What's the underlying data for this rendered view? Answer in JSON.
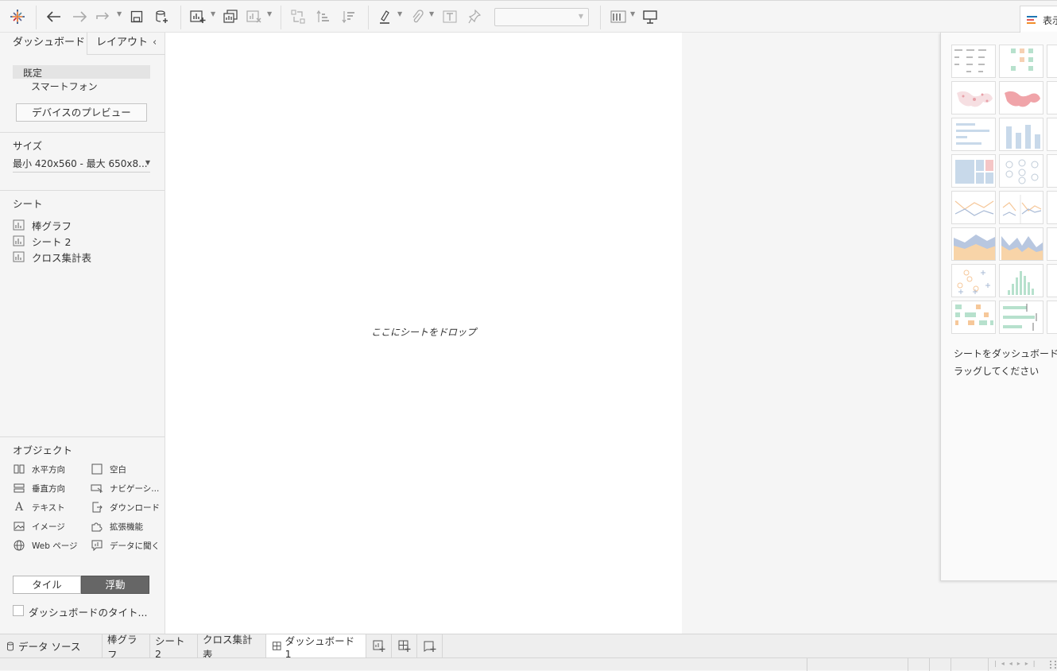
{
  "toolbar": {
    "showme_label": "表示"
  },
  "left_panel": {
    "tabs": [
      "ダッシュボード",
      "レイアウト"
    ],
    "devices": [
      "既定",
      "スマートフォン"
    ],
    "device_preview_button": "デバイスのプレビュー",
    "size_heading": "サイズ",
    "size_value": "最小 420x560 - 最大 650x8...",
    "sheets_heading": "シート",
    "sheets": [
      "棒グラフ",
      "シート 2",
      "クロス集計表"
    ],
    "objects_heading": "オブジェクト",
    "objects": [
      "水平方向",
      "空白",
      "垂直方向",
      "ナビゲーシ...",
      "テキスト",
      "ダウンロード",
      "イメージ",
      "拡張機能",
      "Web ページ",
      "データに聞く"
    ],
    "toggle": [
      "タイル",
      "浮動"
    ],
    "show_title_checkbox": "ダッシュボードのタイト..."
  },
  "canvas": {
    "drop_message": "ここにシートをドロップ"
  },
  "showme": {
    "hint_line1": "シートをダッシュボード",
    "hint_line2": "ラッグしてください"
  },
  "bottom_tabs": [
    "データ ソース",
    "棒グラフ",
    "シート 2",
    "クロス集計表",
    "ダッシュボード 1"
  ],
  "colors": {
    "accent_dark": "#666666",
    "tableau_blue": "#1f77b4",
    "tableau_orange": "#f28e2b",
    "tableau_red": "#e15759"
  }
}
